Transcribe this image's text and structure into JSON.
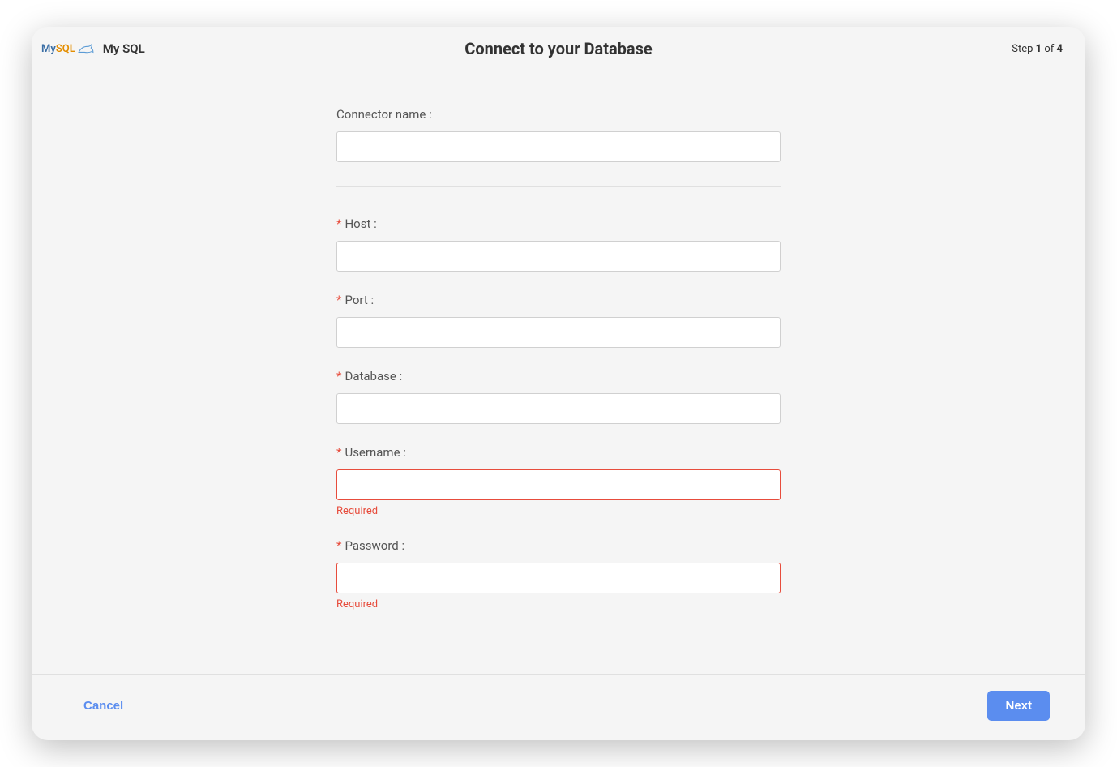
{
  "header": {
    "logo_name": "My SQL",
    "title": "Connect to your Database",
    "step_prefix": "Step",
    "step_current": "1",
    "step_of": "of",
    "step_total": "4"
  },
  "form": {
    "connector_name": {
      "label": "Connector name :",
      "value": "",
      "required": false,
      "has_error": false
    },
    "host": {
      "label": "Host :",
      "value": "",
      "required": true,
      "has_error": false
    },
    "port": {
      "label": "Port :",
      "value": "",
      "required": true,
      "has_error": false
    },
    "database": {
      "label": "Database :",
      "value": "",
      "required": true,
      "has_error": false
    },
    "username": {
      "label": "Username :",
      "value": "",
      "required": true,
      "has_error": true,
      "error_text": "Required"
    },
    "password": {
      "label": "Password :",
      "value": "",
      "required": true,
      "has_error": true,
      "error_text": "Required"
    }
  },
  "footer": {
    "cancel_label": "Cancel",
    "next_label": "Next"
  }
}
